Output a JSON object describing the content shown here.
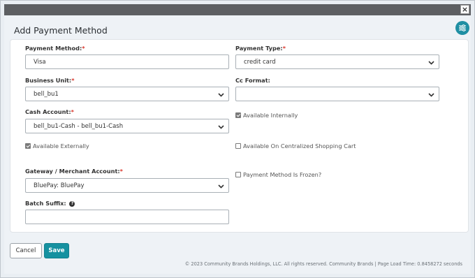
{
  "window": {
    "close_label": "×"
  },
  "dialog": {
    "title": "Add Payment Method"
  },
  "icons": {
    "settings": "sliders-icon",
    "help": "question-circle-icon",
    "chevron": "chevron-down-icon"
  },
  "fields": {
    "payment_method": {
      "label": "Payment Method:",
      "required": "*",
      "value": "Visa"
    },
    "payment_type": {
      "label": "Payment Type:",
      "required": "*",
      "value": "credit card"
    },
    "business_unit": {
      "label": "Business Unit:",
      "required": "*",
      "value": "bell_bu1"
    },
    "cc_format": {
      "label": "Cc Format:",
      "value": ""
    },
    "cash_account": {
      "label": "Cash Account:",
      "required": "*",
      "value": "bell_bu1-Cash - bell_bu1-Cash"
    },
    "available_internally": {
      "label": "Available Internally",
      "checked": true
    },
    "available_externally": {
      "label": "Available Externally",
      "checked": true
    },
    "available_centralized": {
      "label": "Available On Centralized Shopping Cart",
      "checked": false
    },
    "gateway": {
      "label": "Gateway / Merchant Account:",
      "required": "*",
      "value": "BluePay: BluePay"
    },
    "frozen": {
      "label": "Payment Method Is Frozen?",
      "checked": false
    },
    "batch_suffix": {
      "label": "Batch Suffix:",
      "help": "?",
      "value": ""
    }
  },
  "buttons": {
    "cancel": "Cancel",
    "save": "Save"
  },
  "footer": {
    "text": "© 2023 Community Brands Holdings, LLC. All rights reserved. Community Brands | Page Load Time: 0.8458272 seconds"
  },
  "colors": {
    "accent": "#1591a0",
    "required": "#d9362b",
    "topbar": "#5d5f62"
  }
}
